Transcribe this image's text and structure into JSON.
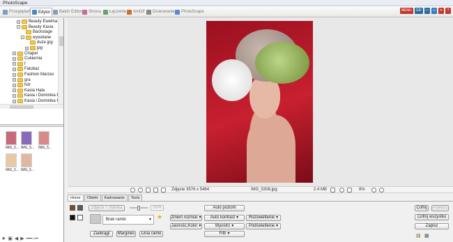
{
  "app": {
    "title": "PhotoScape"
  },
  "tabs": [
    {
      "label": "Przeglądarka",
      "icon": "viewer-icon",
      "color": "#7a9cc8"
    },
    {
      "label": "Edytor",
      "icon": "editor-icon",
      "color": "#4a86c8",
      "active": true
    },
    {
      "label": "Batch Editor",
      "icon": "batch-editor-icon",
      "color": "#8aa0b8"
    },
    {
      "label": "Strona",
      "icon": "page-icon",
      "color": "#c86a9a"
    },
    {
      "label": "Łączenie",
      "icon": "combine-icon",
      "color": "#6aa06a"
    },
    {
      "label": "AniGif",
      "icon": "anigif-icon",
      "color": "#d07030"
    },
    {
      "label": "Drukowanie",
      "icon": "print-icon",
      "color": "#888888"
    },
    {
      "label": "PhotoScape",
      "icon": "photoscape-icon",
      "color": "#5a8ad0"
    }
  ],
  "window_buttons": [
    {
      "label": "MENU",
      "color": "#c0392b"
    },
    {
      "label": "GIF",
      "color": "#2c6aa0"
    },
    {
      "label": "□",
      "color": "#2c6aa0"
    },
    {
      "label": "▭",
      "color": "#3a7ab8"
    },
    {
      "label": "✕",
      "color": "#c0392b"
    },
    {
      "label": "?",
      "color": "#c0392b"
    }
  ],
  "tree": [
    {
      "label": "Beauty Ewelina",
      "level": 1,
      "expander": "+"
    },
    {
      "label": "Beauty Kasia",
      "level": 1,
      "expander": "-"
    },
    {
      "label": "Backstage",
      "level": 2,
      "expander": ""
    },
    {
      "label": "wywolane",
      "level": 2,
      "expander": "-"
    },
    {
      "label": "duze jpg",
      "level": 3,
      "expander": ""
    },
    {
      "label": "jpg",
      "level": 3,
      "expander": "+"
    },
    {
      "label": "Chapel",
      "level": 0,
      "expander": "+"
    },
    {
      "label": "Cukiernia",
      "level": 0,
      "expander": "+"
    },
    {
      "label": "f",
      "level": 0,
      "expander": "+"
    },
    {
      "label": "Falubaz",
      "level": 0,
      "expander": "+"
    },
    {
      "label": "Fashion Marzec",
      "level": 0,
      "expander": "+"
    },
    {
      "label": "gra",
      "level": 0,
      "expander": "+"
    },
    {
      "label": "hdr",
      "level": 0,
      "expander": "+"
    },
    {
      "label": "Kasia Hala",
      "level": 0,
      "expander": "+"
    },
    {
      "label": "Kasia i Dominika B",
      "level": 0,
      "expander": "+"
    },
    {
      "label": "Kasia i Dominika F",
      "level": 0,
      "expander": "+"
    }
  ],
  "thumbnails": [
    {
      "caption": "IMG_5...",
      "color": "#c86a7a"
    },
    {
      "caption": "IMG_5...",
      "color": "#8a6ab8"
    },
    {
      "caption": "IMG_5...",
      "color": "#d88a8a"
    },
    {
      "caption": "IMG_5...",
      "color": "#e8c8a8"
    },
    {
      "caption": "IMG_5...",
      "color": "#e0b8a0"
    }
  ],
  "status": {
    "dimensions": "Zdjęcie 3576 x 5464",
    "filename": "IMG_5308.jpg",
    "filesize": "2.4 MB",
    "zoom": "8%"
  },
  "subtabs": [
    "Home",
    "Obiekt",
    "Kadrowanie",
    "Tools"
  ],
  "home": {
    "photo_frame": "Zdjęcie + Ramka",
    "slider_pct": "100%",
    "frame_value": "Brak ramki",
    "round": "Zaokrągl",
    "margins": "Marginės",
    "frame_line": "Linia ramki",
    "resize": "Zmień rozmiar",
    "bright_color": "Jasność,Kolor",
    "auto_level": "Auto poziom",
    "auto_contrast": "Auto kontrast",
    "sharpen": "Wyostrz",
    "filter": "Filtr",
    "backlight": "Rozświetlenie",
    "lighting": "Podświetlenie",
    "undo": "Cofnij",
    "redo": "Powtórz",
    "undo_all": "Cofnij wszystko",
    "save": "Zapisz"
  }
}
